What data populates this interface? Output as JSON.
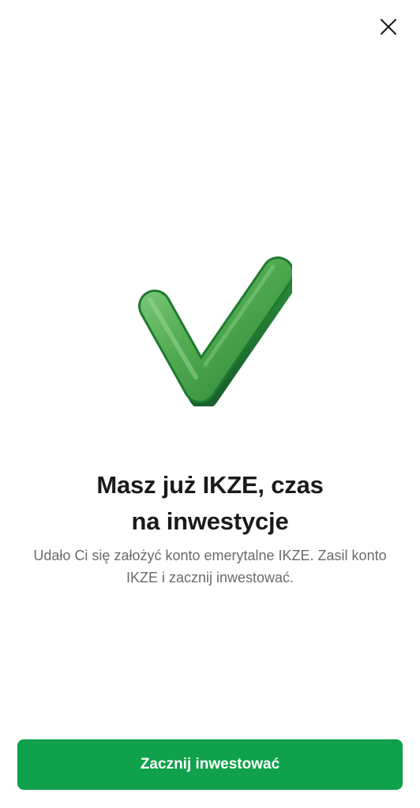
{
  "header": {
    "close_icon": "close-icon"
  },
  "illustration": {
    "icon": "checkmark-icon",
    "color": "#3aa04a"
  },
  "content": {
    "title_line1": "Masz już IKZE, czas",
    "title_line2": "na inwestycje",
    "description": "Udało Ci się założyć konto emerytalne IKZE. Zasil konto IKZE i zacznij inwestować."
  },
  "actions": {
    "primary_label": "Zacznij inwestować",
    "primary_color": "#0fa14b"
  }
}
